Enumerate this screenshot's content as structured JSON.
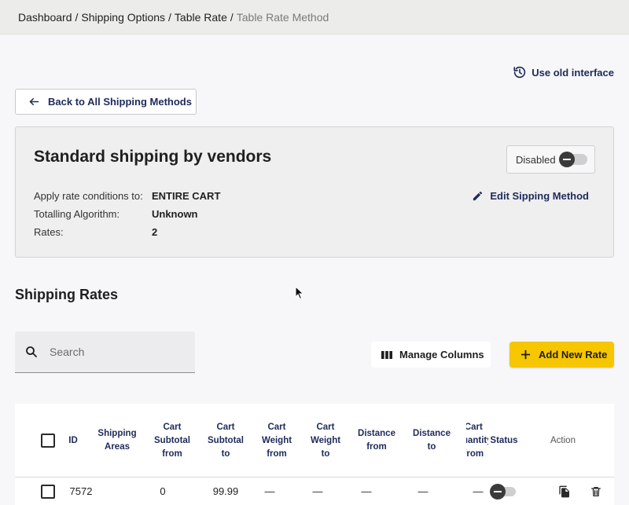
{
  "breadcrumb": {
    "items": [
      "Dashboard",
      "Shipping Options",
      "Table Rate"
    ],
    "current": "Table Rate Method",
    "separator": "/"
  },
  "header_actions": {
    "old_interface_label": "Use old interface"
  },
  "back_button": {
    "label": "Back to All Shipping Methods"
  },
  "method_card": {
    "title": "Standard shipping by vendors",
    "status_label": "Disabled",
    "edit_label": "Edit Sipping Method",
    "details": [
      {
        "label": "Apply rate conditions to:",
        "value": "ENTIRE CART"
      },
      {
        "label": "Totalling Algorithm:",
        "value": "Unknown"
      },
      {
        "label": "Rates:",
        "value": "2"
      }
    ]
  },
  "rates_section": {
    "title": "Shipping Rates",
    "search_placeholder": "Search",
    "manage_columns_label": "Manage Columns",
    "add_rate_label": "Add New Rate"
  },
  "table": {
    "columns": {
      "id": "ID",
      "shipping_areas": "Shipping Areas",
      "cart_subtotal_from": "Cart Subtotal from",
      "cart_subtotal_to": "Cart Subtotal to",
      "cart_weight_from": "Cart Weight from",
      "cart_weight_to": "Cart Weight to",
      "distance_from": "Distance from",
      "distance_to": "Distance to",
      "cart_quantity_from": "Cart Quantity from",
      "status": "Status",
      "action": "Action"
    },
    "rows": [
      {
        "id": "7572",
        "cart_subtotal_from": "0",
        "cart_subtotal_to": "99.99",
        "cart_weight_from": "—",
        "cart_weight_to": "—",
        "distance_from": "—",
        "distance_to": "—",
        "cart_quantity_from": "—"
      }
    ]
  },
  "colors": {
    "accent_navy": "#1e2a5a",
    "primary_yellow": "#f6c600",
    "topbar_bg": "#ececea",
    "card_bg": "#efeff0"
  },
  "icons": {
    "old_interface": "history-icon",
    "back": "arrow-left-icon",
    "edit": "pencil-icon",
    "search": "search-icon",
    "columns": "columns-icon",
    "add": "plus-icon",
    "duplicate": "copy-icon",
    "delete": "trash-icon"
  }
}
